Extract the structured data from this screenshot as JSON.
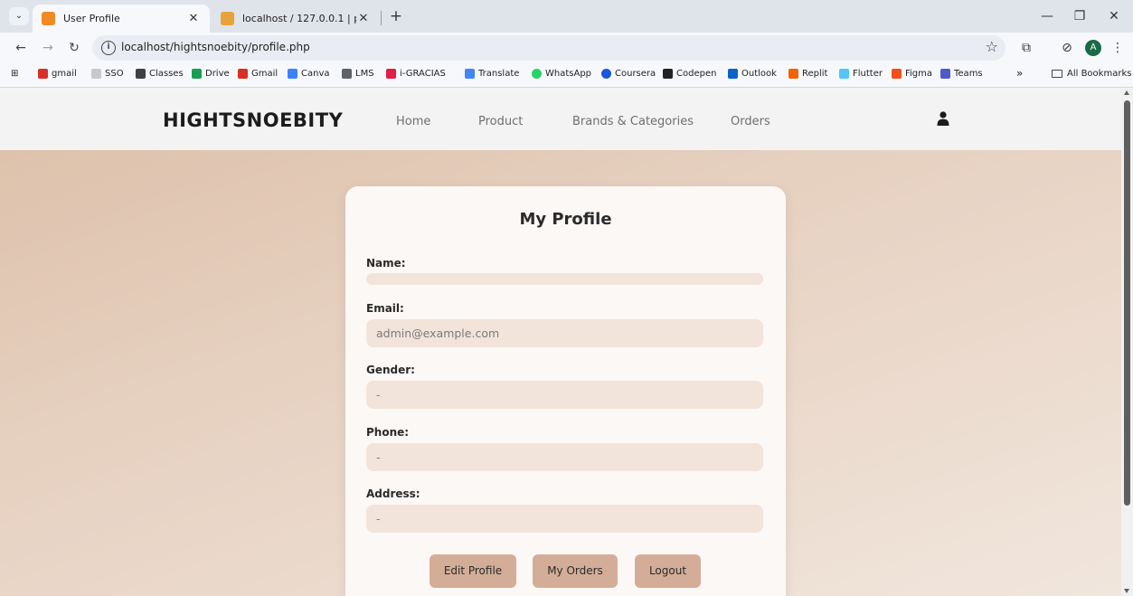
{
  "browser": {
    "tabs": [
      {
        "title": "User Profile",
        "favicon_color": "#f08a24",
        "active": true
      },
      {
        "title": "localhost / 127.0.0.1 | phpMyAd",
        "favicon_color": "#e8a23a",
        "active": false
      }
    ],
    "url": "localhost/hightsnoebity/profile.php",
    "profile_initial": "A",
    "bookmarks": [
      {
        "label": "gmail",
        "color": "#d93025"
      },
      {
        "label": "SSO",
        "color": "#c9c9c9"
      },
      {
        "label": "Classes",
        "color": "#3c4043"
      },
      {
        "label": "Drive",
        "color": "#1a9e52"
      },
      {
        "label": "Gmail",
        "color": "#d93025"
      },
      {
        "label": "Canva",
        "color": "#3b82f6"
      },
      {
        "label": "LMS",
        "color": "#5f6368"
      },
      {
        "label": "i-GRACIAS",
        "color": "#e11d48"
      },
      {
        "label": "Translate",
        "color": "#4285f4"
      },
      {
        "label": "WhatsApp",
        "color": "#25d366"
      },
      {
        "label": "Coursera",
        "color": "#1a56db"
      },
      {
        "label": "Codepen",
        "color": "#222222"
      },
      {
        "label": "Outlook",
        "color": "#0a64c8"
      },
      {
        "label": "Replit",
        "color": "#f26207"
      },
      {
        "label": "Flutter",
        "color": "#54c5f8"
      },
      {
        "label": "Figma",
        "color": "#f24e1e"
      },
      {
        "label": "Teams",
        "color": "#5059c9"
      }
    ],
    "overflow": "»",
    "all_bookmarks": "All Bookmarks"
  },
  "site": {
    "brand": "HIGHTSNOEBITY",
    "nav": [
      "Home",
      "Product",
      "Brands & Categories",
      "Orders"
    ]
  },
  "profile": {
    "title": "My Profile",
    "fields": [
      {
        "label": "Name:",
        "value": ""
      },
      {
        "label": "Email:",
        "value": "admin@example.com"
      },
      {
        "label": "Gender:",
        "value": "-"
      },
      {
        "label": "Phone:",
        "value": "-"
      },
      {
        "label": "Address:",
        "value": "-"
      }
    ],
    "buttons": [
      "Edit Profile",
      "My Orders",
      "Logout"
    ]
  }
}
